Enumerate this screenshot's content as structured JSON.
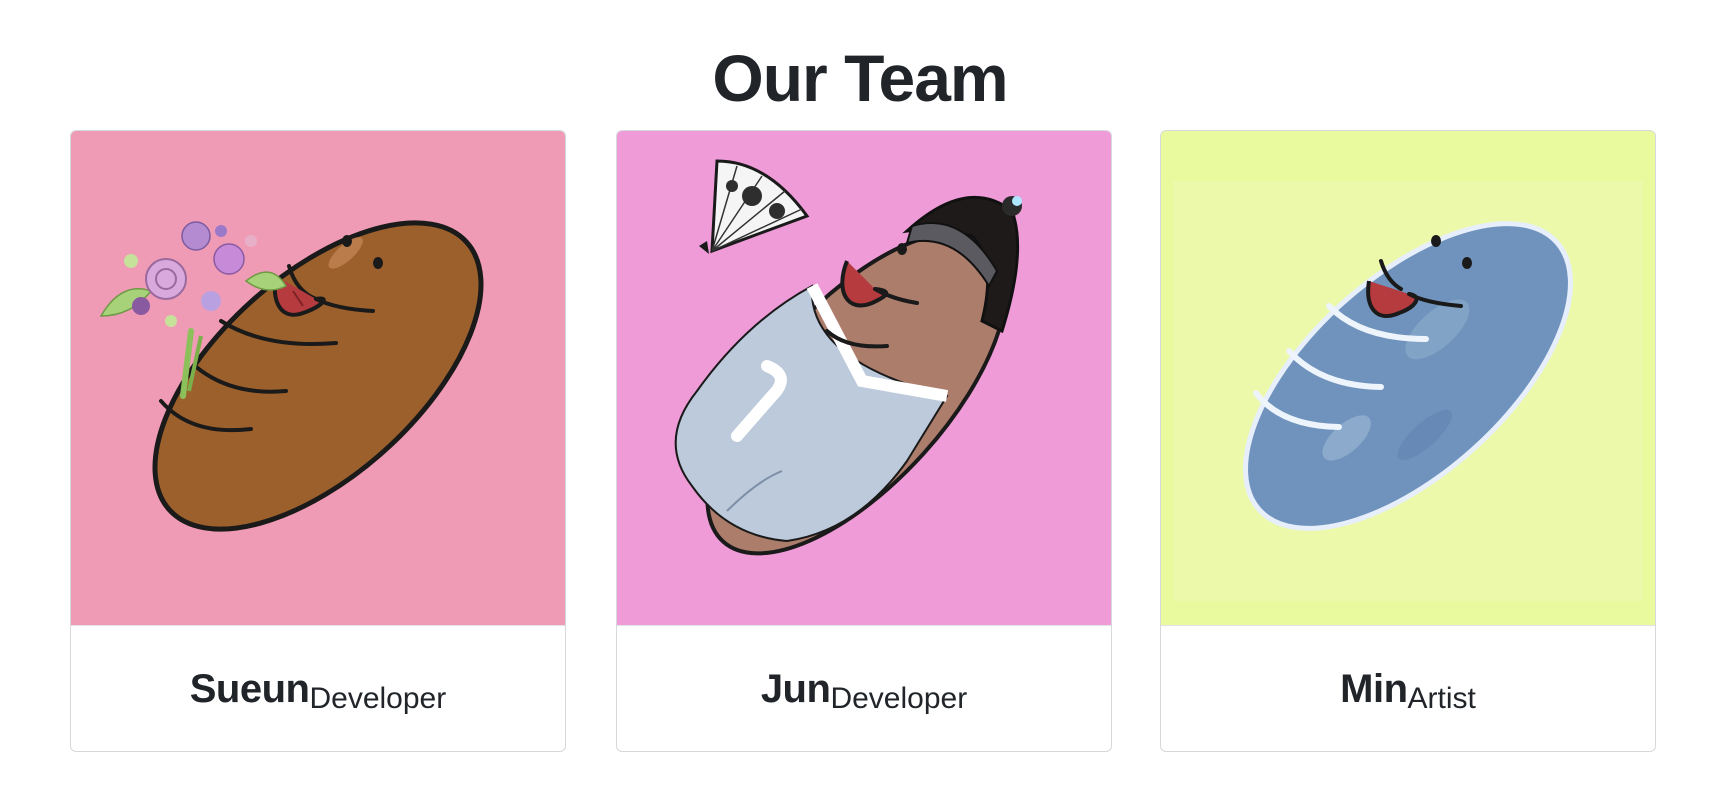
{
  "page": {
    "title": "Our Team"
  },
  "members": [
    {
      "name": "Sueun",
      "role": "Developer",
      "bg_color": "#f09bb5",
      "bread_color": "#9c602c",
      "image_icon": "bread-with-bouquet-icon"
    },
    {
      "name": "Jun",
      "role": "Developer",
      "bg_color": "#ef9bd8",
      "bread_color": "#ad7d6c",
      "image_icon": "bread-in-hanbok-icon"
    },
    {
      "name": "Min",
      "role": "Artist",
      "bg_color": "#e8f99e",
      "bread_color": "#6f93bd",
      "image_icon": "blue-bread-icon"
    }
  ]
}
